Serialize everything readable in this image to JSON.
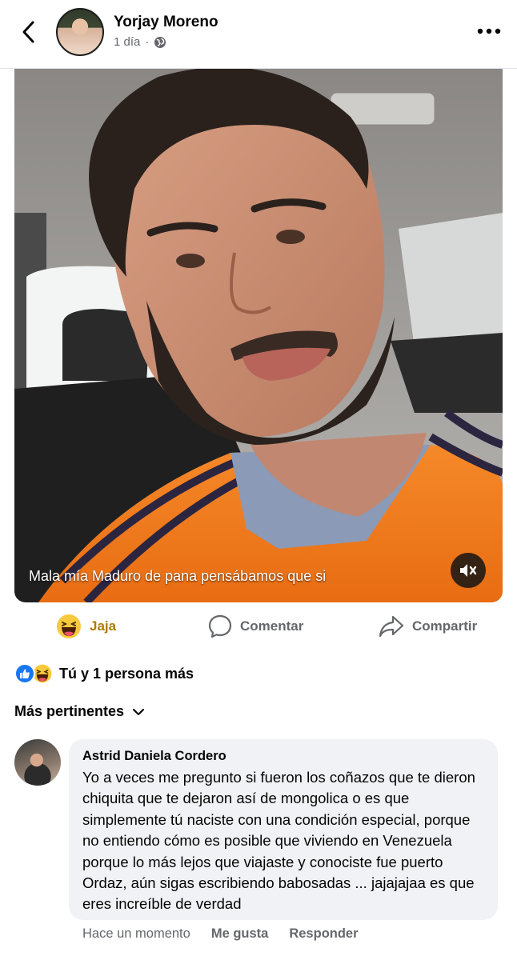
{
  "post": {
    "author": "Yorjay Moreno",
    "time": "1 día",
    "separator": "·",
    "privacy_icon": "globe-icon"
  },
  "video": {
    "caption": "Mala mía Maduro de pana pensábamos que si",
    "mute_icon": "speaker-muted-icon"
  },
  "actions": {
    "reaction_label": "Jaja",
    "comment_label": "Comentar",
    "share_label": "Compartir"
  },
  "reactions": {
    "summary": "Tú y 1 persona más",
    "icons": [
      "like-icon",
      "haha-icon"
    ]
  },
  "comments": {
    "sort_label": "Más pertinentes",
    "items": [
      {
        "author": "Astrid Daniela Cordero",
        "text": "Yo a veces me pregunto si fueron los coñazos que te dieron chiquita que te dejaron así de mongolica o es que simplemente tú naciste con una condición especial, porque no entiendo cómo es posible que viviendo en Venezuela porque lo más lejos que viajaste y conociste fue puerto Ordaz, aún sigas escribiendo babosadas ... jajajajaa es que eres increíble de verdad",
        "time": "Hace un momento",
        "like_label": "Me gusta",
        "reply_label": "Responder"
      }
    ]
  },
  "colors": {
    "haha_accent": "#b07a00",
    "like_blue": "#1877f2",
    "secondary_text": "#65676b",
    "bubble_bg": "#f0f2f5",
    "jersey_orange": "#f07a1e"
  }
}
